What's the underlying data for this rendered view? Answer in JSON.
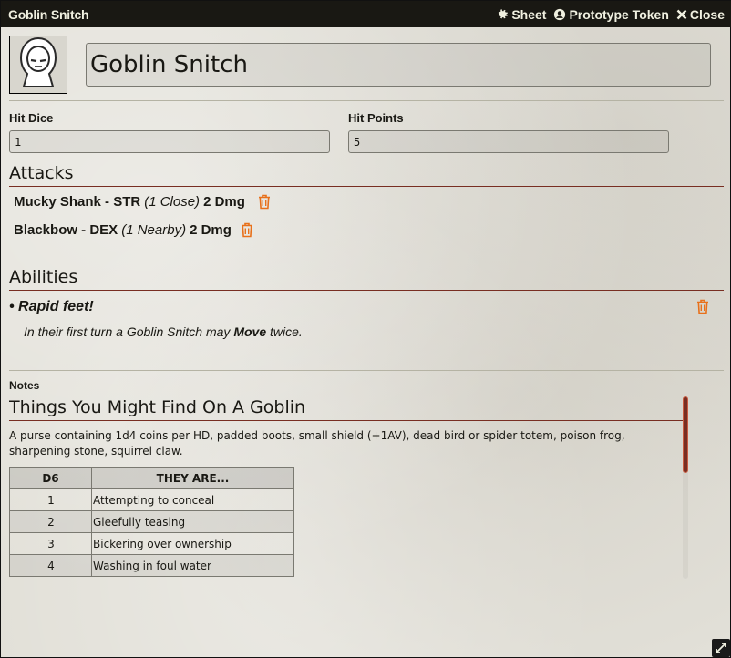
{
  "window": {
    "title": "Goblin Snitch",
    "controls": {
      "sheet": "Sheet",
      "prototype_token": "Prototype Token",
      "close": "Close"
    }
  },
  "actor": {
    "name": "Goblin Snitch",
    "portrait_icon": "hooded-figure-icon"
  },
  "fields": {
    "hit_dice": {
      "label": "Hit Dice",
      "value": "1"
    },
    "hit_points": {
      "label": "Hit Points",
      "value": "5"
    }
  },
  "attacks": {
    "title": "Attacks",
    "items": [
      {
        "name": "Mucky Shank - STR",
        "range": "(1 Close)",
        "damage": "2 Dmg"
      },
      {
        "name": "Blackbow - DEX",
        "range": "(1 Nearby)",
        "damage": "2 Dmg"
      }
    ]
  },
  "abilities": {
    "title": "Abilities",
    "items": [
      {
        "name": "• Rapid feet!",
        "desc_pre": "In their first turn a Goblin Snitch may ",
        "desc_bold": "Move",
        "desc_post": " twice."
      }
    ]
  },
  "notes": {
    "label": "Notes",
    "heading": "Things You Might Find On A Goblin",
    "paragraph": "A purse containing 1d4 coins per HD, padded boots, small shield (+1AV), dead bird or spider totem, poison frog, sharpening stone, squirrel claw.",
    "table": {
      "headers": [
        "D6",
        "THEY ARE..."
      ],
      "rows": [
        [
          "1",
          "Attempting to conceal"
        ],
        [
          "2",
          "Gleefully teasing"
        ],
        [
          "3",
          "Bickering over ownership"
        ],
        [
          "4",
          "Washing in foul water"
        ]
      ]
    }
  },
  "colors": {
    "accent": "#782e22",
    "trash": "#e8701a",
    "titlebar": "#191813"
  }
}
